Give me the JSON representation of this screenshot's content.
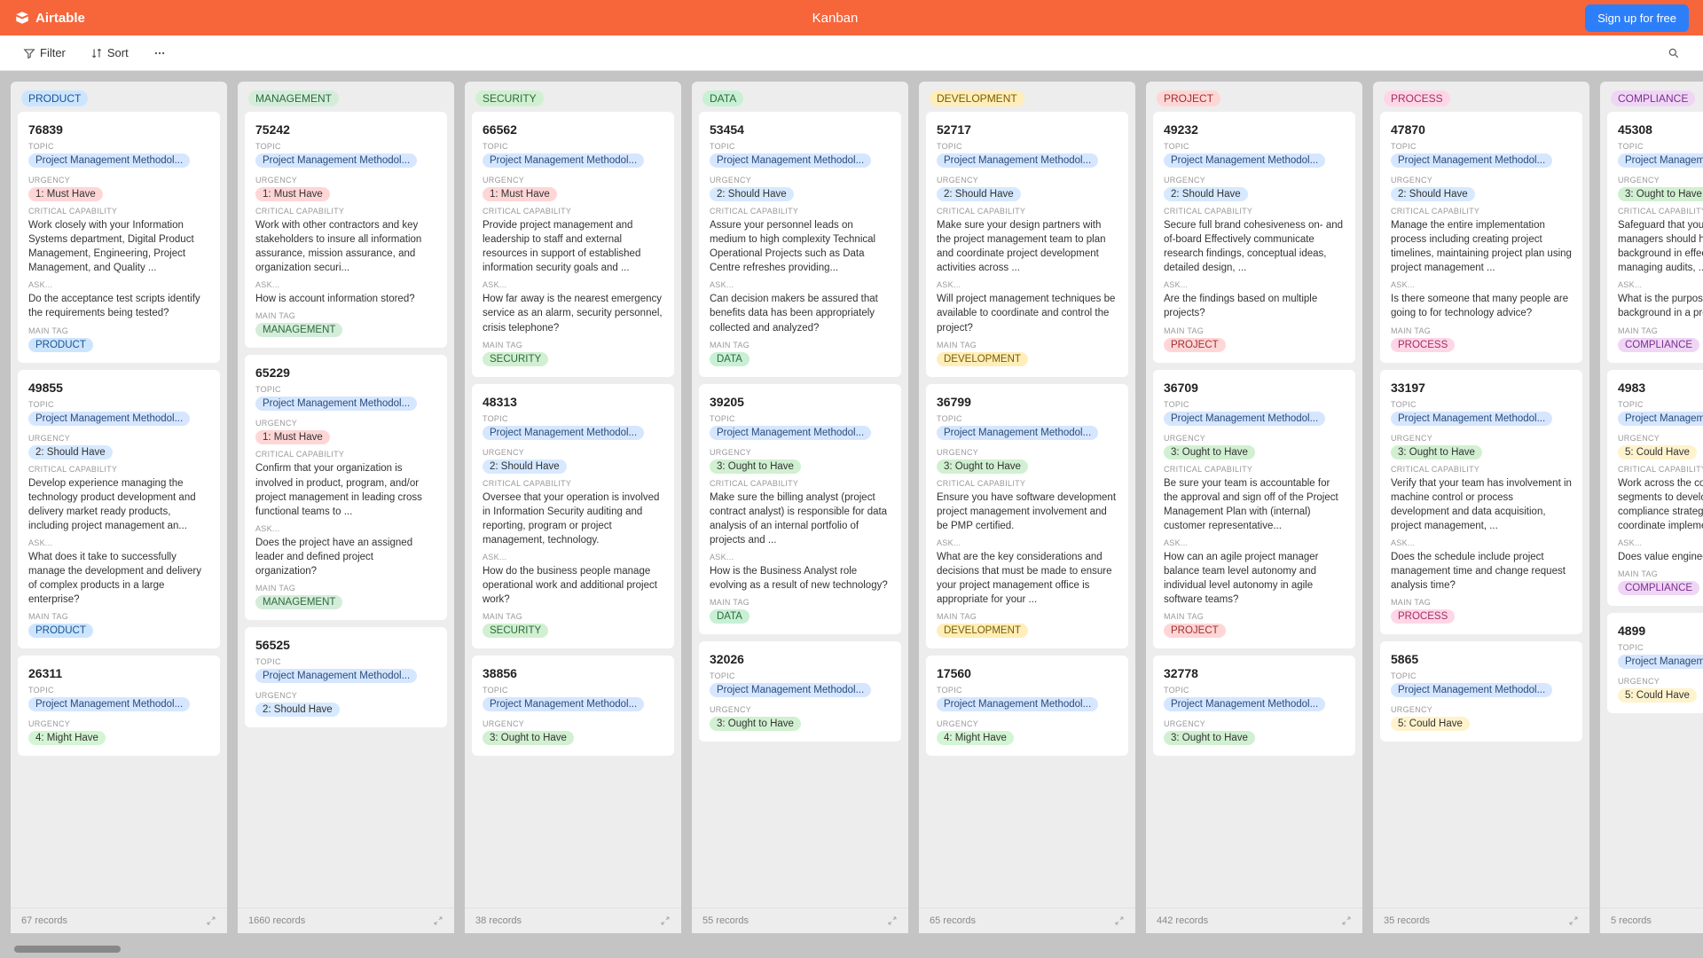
{
  "topbar": {
    "logo_text": "Airtable",
    "title": "Kanban",
    "signup": "Sign up for free"
  },
  "toolbar": {
    "filter": "Filter",
    "sort": "Sort"
  },
  "labels": {
    "topic": "TOPIC",
    "urgency": "URGENCY",
    "critical": "CRITICAL CAPABILITY",
    "ask": "ASK...",
    "maintag": "MAIN TAG",
    "records_suffix": " records"
  },
  "topic_value": "Project Management Methodol...",
  "urgency": {
    "must": "1: Must Have",
    "should": "2: Should Have",
    "ought": "3: Ought to Have",
    "might": "4: Might Have",
    "could": "5: Could Have"
  },
  "columns": [
    {
      "name": "PRODUCT",
      "tag_class": "c-product",
      "records": "67",
      "cards": [
        {
          "id": "76839",
          "urgency": "must",
          "critical": "Work closely with your Information Systems department, Digital Product Management, Engineering, Project Management, and Quality ...",
          "ask": "Do the acceptance test scripts identify the requirements being tested?",
          "tag": "PRODUCT",
          "tagc": "c-product"
        },
        {
          "id": "49855",
          "urgency": "should",
          "critical": "Develop experience managing the technology product development and delivery market ready products, including project management an...",
          "ask": "What does it take to successfully manage the development and delivery of complex products in a large enterprise?",
          "tag": "PRODUCT",
          "tagc": "c-product"
        },
        {
          "id": "26311",
          "urgency": "might",
          "critical": "",
          "ask": "",
          "tag": "",
          "tagc": ""
        }
      ]
    },
    {
      "name": "MANAGEMENT",
      "tag_class": "c-management",
      "records": "1660",
      "cards": [
        {
          "id": "75242",
          "urgency": "must",
          "critical": "Work with other contractors and key stakeholders to insure all information assurance, mission assurance, and organization securi...",
          "ask": "How is account information stored?",
          "tag": "MANAGEMENT",
          "tagc": "c-management"
        },
        {
          "id": "65229",
          "urgency": "must",
          "critical": "Confirm that your organization is involved in product, program, and/or project management in leading cross functional teams to ...",
          "ask": "Does the project have an assigned leader and defined project organization?",
          "tag": "MANAGEMENT",
          "tagc": "c-management"
        },
        {
          "id": "56525",
          "urgency": "should",
          "critical": "",
          "ask": "",
          "tag": "",
          "tagc": ""
        }
      ]
    },
    {
      "name": "SECURITY",
      "tag_class": "c-security",
      "records": "38",
      "cards": [
        {
          "id": "66562",
          "urgency": "must",
          "critical": "Provide project management and leadership to staff and external resources in support of established information security goals and ...",
          "ask": "How far away is the nearest emergency service as an alarm, security personnel, crisis telephone?",
          "tag": "SECURITY",
          "tagc": "c-security"
        },
        {
          "id": "48313",
          "urgency": "should",
          "critical": "Oversee that your operation is involved in Information Security auditing and reporting, program or project management, technology.",
          "ask": "How do the business people manage operational work and additional project work?",
          "tag": "SECURITY",
          "tagc": "c-security"
        },
        {
          "id": "38856",
          "urgency": "ought",
          "critical": "",
          "ask": "",
          "tag": "",
          "tagc": ""
        }
      ]
    },
    {
      "name": "DATA",
      "tag_class": "c-data",
      "records": "55",
      "cards": [
        {
          "id": "53454",
          "urgency": "should",
          "critical": "Assure your personnel leads on medium to high complexity Technical Operational Projects such as Data Centre refreshes providing...",
          "ask": "Can decision makers be assured that benefits data has been appropriately collected and analyzed?",
          "tag": "DATA",
          "tagc": "c-data"
        },
        {
          "id": "39205",
          "urgency": "ought",
          "critical": "Make sure the billing analyst (project contract analyst) is responsible for data analysis of an internal portfolio of projects and ...",
          "ask": "How is the Business Analyst role evolving as a result of new technology?",
          "tag": "DATA",
          "tagc": "c-data"
        },
        {
          "id": "32026",
          "urgency": "ought",
          "critical": "",
          "ask": "",
          "tag": "",
          "tagc": ""
        }
      ]
    },
    {
      "name": "DEVELOPMENT",
      "tag_class": "c-development",
      "records": "65",
      "cards": [
        {
          "id": "52717",
          "urgency": "should",
          "critical": "Make sure your design partners with the project management team to plan and coordinate project development activities across ...",
          "ask": "Will project management techniques be available to coordinate and control the project?",
          "tag": "DEVELOPMENT",
          "tagc": "c-development"
        },
        {
          "id": "36799",
          "urgency": "ought",
          "critical": "Ensure you have software development project management involvement and be PMP certified.",
          "ask": "What are the key considerations and decisions that must be made to ensure your project management office is appropriate for your ...",
          "tag": "DEVELOPMENT",
          "tagc": "c-development"
        },
        {
          "id": "17560",
          "urgency": "might",
          "critical": "",
          "ask": "",
          "tag": "",
          "tagc": ""
        }
      ]
    },
    {
      "name": "PROJECT",
      "tag_class": "c-project",
      "records": "442",
      "cards": [
        {
          "id": "49232",
          "urgency": "should",
          "critical": "Secure full brand cohesiveness on- and of-board Effectively communicate research findings, conceptual ideas, detailed design, ...",
          "ask": "Are the findings based on multiple projects?",
          "tag": "PROJECT",
          "tagc": "c-project"
        },
        {
          "id": "36709",
          "urgency": "ought",
          "critical": "Be sure your team is accountable for the approval and sign off of the Project Management Plan with (internal) customer representative...",
          "ask": "How can an agile project manager balance team level autonomy and individual level autonomy in agile software teams?",
          "tag": "PROJECT",
          "tagc": "c-project"
        },
        {
          "id": "32778",
          "urgency": "ought",
          "critical": "",
          "ask": "",
          "tag": "",
          "tagc": ""
        }
      ]
    },
    {
      "name": "PROCESS",
      "tag_class": "c-process",
      "records": "35",
      "cards": [
        {
          "id": "47870",
          "urgency": "should",
          "critical": "Manage the entire implementation process including creating project timelines, maintaining project plan using project management ...",
          "ask": "Is there someone that many people are going to for technology advice?",
          "tag": "PROCESS",
          "tagc": "c-process"
        },
        {
          "id": "33197",
          "urgency": "ought",
          "critical": "Verify that your team has involvement in machine control or process development and data acquisition, project management, ...",
          "ask": "Does the schedule include project management time and change request analysis time?",
          "tag": "PROCESS",
          "tagc": "c-process"
        },
        {
          "id": "5865",
          "urgency": "could",
          "critical": "",
          "ask": "",
          "tag": "",
          "tagc": ""
        }
      ]
    },
    {
      "name": "COMPLIANCE",
      "tag_class": "c-compliance",
      "records": "5",
      "cards": [
        {
          "id": "45308",
          "urgency": "ought",
          "critical": "Safeguard that your company managers should have a strong background in effective communication, managing audits, ...",
          "ask": "What is the purpose of the project background in a project workplan?",
          "tag": "COMPLIANCE",
          "tagc": "c-compliance"
        },
        {
          "id": "4983",
          "urgency": "could",
          "critical": "Work across the controls business segments to develop a certification and compliance strategy/roadmap and coordinate implementation ...",
          "ask": "Does value engineering take place?",
          "tag": "COMPLIANCE",
          "tagc": "c-compliance"
        },
        {
          "id": "4899",
          "urgency": "could",
          "critical": "",
          "ask": "",
          "tag": "",
          "tagc": ""
        }
      ]
    }
  ]
}
